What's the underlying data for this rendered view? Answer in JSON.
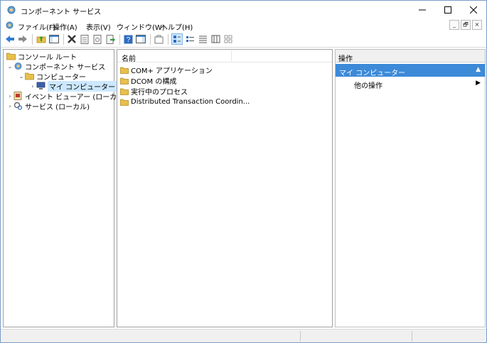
{
  "window": {
    "title": "コンポーネント サービス"
  },
  "menu": {
    "items": [
      "ファイル(F)",
      "操作(A)",
      "表示(V)",
      "ウィンドウ(W)",
      "ヘルプ(H)"
    ],
    "mdi": [
      "_",
      "🗗",
      "×"
    ]
  },
  "toolbar": {
    "icons": [
      "back-icon",
      "forward-icon",
      "up-folder-icon",
      "show-hide-tree-icon",
      "delete-icon",
      "properties-icon",
      "refresh-icon",
      "export-icon",
      "help-icon",
      "action-pane-icon",
      "new-window-icon",
      "large-icons-icon",
      "small-icons-icon",
      "list-view-icon",
      "detail-view-icon",
      "tile-icon"
    ]
  },
  "tree": {
    "items": [
      {
        "label": "コンソール ルート",
        "chevron": "",
        "icon": "folder-icon",
        "level": 0
      },
      {
        "label": "コンポーネント サービス",
        "chevron": "⌄",
        "icon": "component-services-icon",
        "level": 1
      },
      {
        "label": "コンピューター",
        "chevron": "⌄",
        "icon": "folder-icon",
        "level": 2
      },
      {
        "label": "マイ コンピューター",
        "chevron": "›",
        "icon": "my-computer-icon",
        "level": 3,
        "selected": true
      },
      {
        "label": "イベント ビューアー (ローカル)",
        "chevron": "›",
        "icon": "event-viewer-icon",
        "level": 1
      },
      {
        "label": "サービス (ローカル)",
        "chevron": "›",
        "icon": "services-icon",
        "level": 1
      }
    ]
  },
  "list": {
    "column": "名前",
    "items": [
      "COM+ アプリケーション",
      "DCOM の構成",
      "実行中のプロセス",
      "Distributed Transaction Coordin..."
    ]
  },
  "actions": {
    "header": "操作",
    "section": "マイ コンピューター",
    "section_arrow": "▲",
    "item": "他の操作",
    "item_arrow": "▶"
  },
  "colors": {
    "selection": "#cce8ff",
    "action_section": "#3c8ad8",
    "folder": "#e8c04a"
  }
}
